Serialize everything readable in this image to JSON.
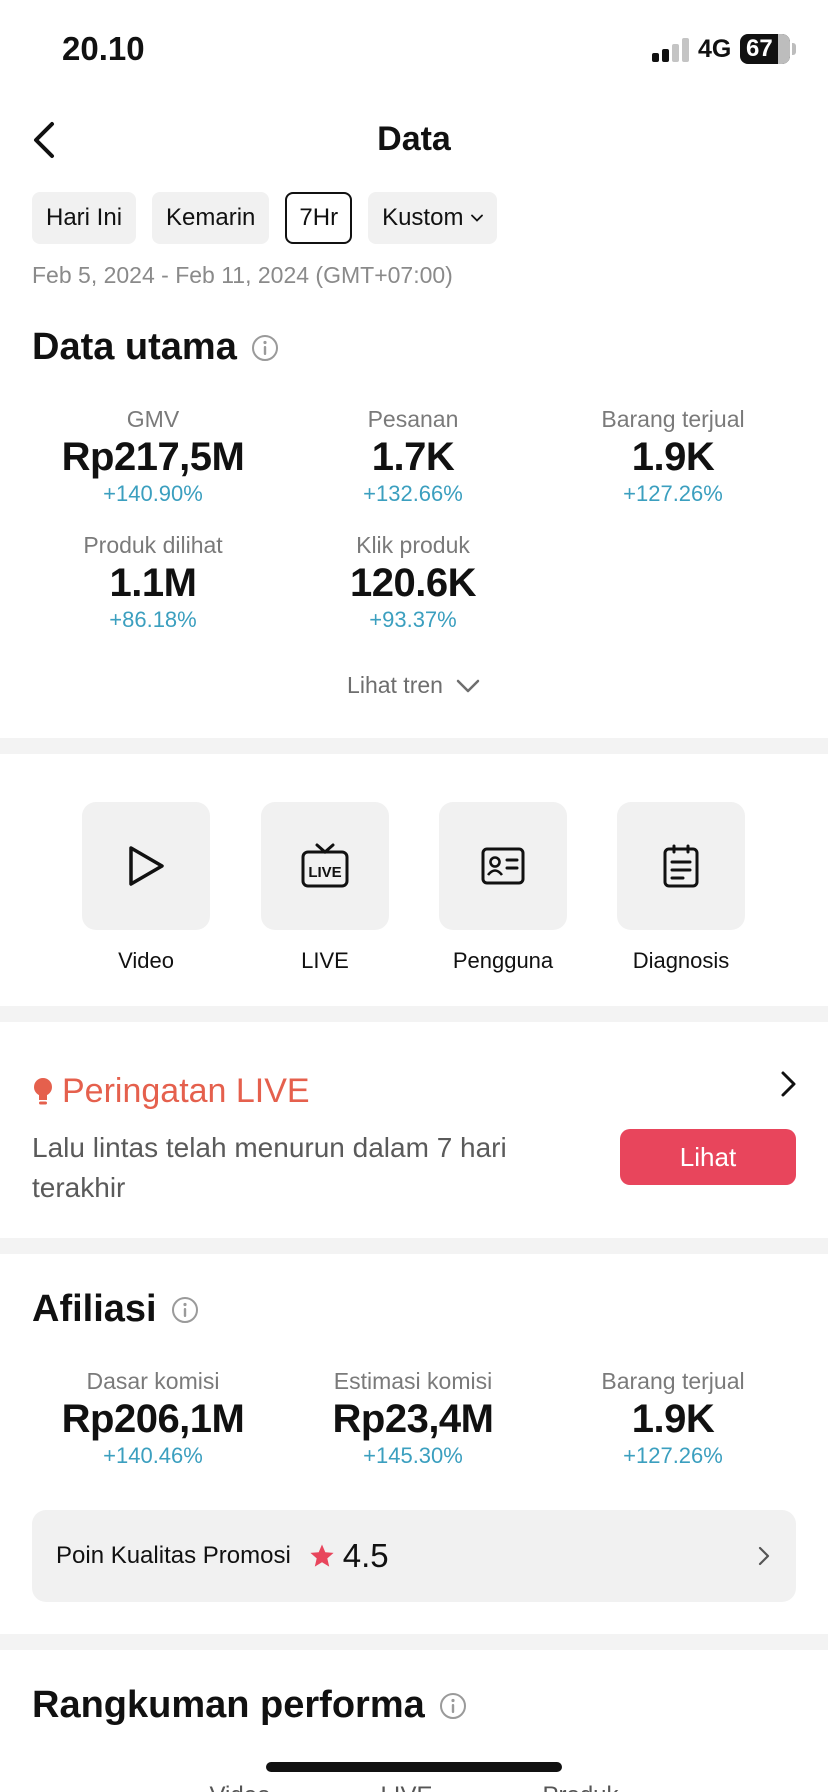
{
  "status_bar": {
    "time": "20.10",
    "network": "4G",
    "battery": "67"
  },
  "header": {
    "title": "Data"
  },
  "filters": {
    "chips": [
      {
        "label": "Hari Ini"
      },
      {
        "label": "Kemarin"
      },
      {
        "label": "7Hr"
      },
      {
        "label": "Kustom"
      }
    ],
    "selected": "7Hr",
    "date_range": "Feb 5, 2024 - Feb 11, 2024 (GMT+07:00)"
  },
  "main_data": {
    "title": "Data utama",
    "metrics": [
      {
        "label": "GMV",
        "value": "Rp217,5M",
        "change": "+140.90%"
      },
      {
        "label": "Pesanan",
        "value": "1.7K",
        "change": "+132.66%"
      },
      {
        "label": "Barang terjual",
        "value": "1.9K",
        "change": "+127.26%"
      },
      {
        "label": "Produk dilihat",
        "value": "1.1M",
        "change": "+86.18%"
      },
      {
        "label": "Klik produk",
        "value": "120.6K",
        "change": "+93.37%"
      }
    ],
    "trend_label": "Lihat tren"
  },
  "shortcuts": [
    {
      "label": "Video",
      "icon": "play-icon"
    },
    {
      "label": "LIVE",
      "icon": "live-tv-icon"
    },
    {
      "label": "Pengguna",
      "icon": "user-card-icon"
    },
    {
      "label": "Diagnosis",
      "icon": "clipboard-icon"
    }
  ],
  "live_warning": {
    "title": "Peringatan LIVE",
    "message": "Lalu lintas telah menurun dalam 7 hari terakhir",
    "button_label": "Lihat",
    "accent_color": "#e5604d",
    "button_color": "#e8455c"
  },
  "affiliate": {
    "title": "Afiliasi",
    "metrics": [
      {
        "label": "Dasar komisi",
        "value": "Rp206,1M",
        "change": "+140.46%"
      },
      {
        "label": "Estimasi komisi",
        "value": "Rp23,4M",
        "change": "+145.30%"
      },
      {
        "label": "Barang terjual",
        "value": "1.9K",
        "change": "+127.26%"
      }
    ],
    "promo_quality": {
      "label": "Poin Kualitas Promosi",
      "score": "4.5"
    }
  },
  "performance_summary": {
    "title": "Rangkuman performa",
    "tabs": [
      "Video",
      "LIVE",
      "Produk"
    ]
  },
  "colors": {
    "change_positive": "#3b9fbf",
    "chip_bg": "#f1f1f1"
  }
}
